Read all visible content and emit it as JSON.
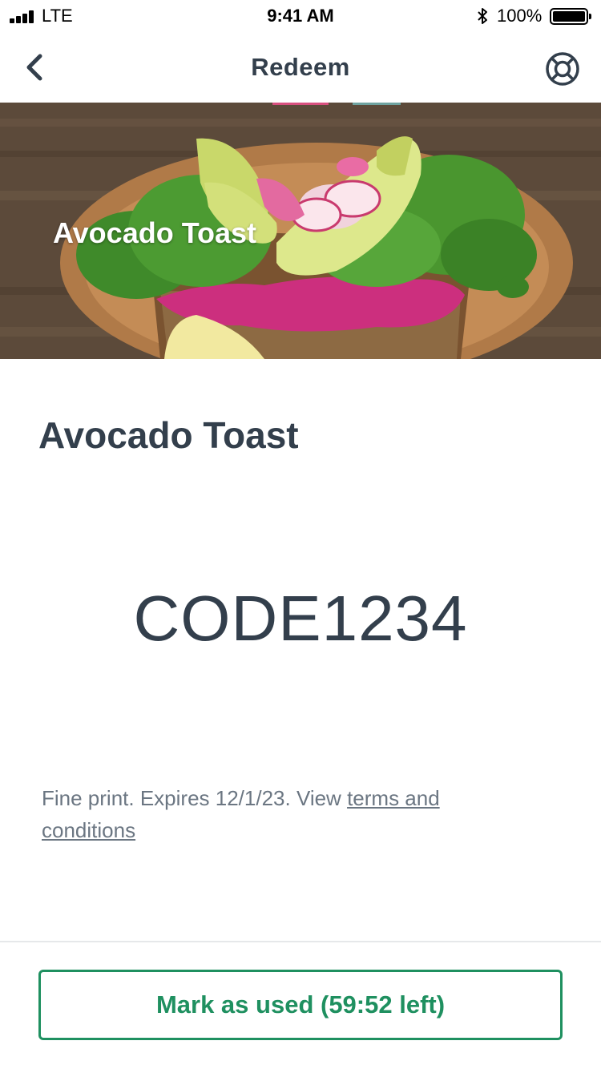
{
  "status_bar": {
    "carrier": "LTE",
    "time": "9:41 AM",
    "battery_percent": "100%",
    "battery_level": 1.0
  },
  "nav": {
    "title": "Redeem",
    "back_icon": "chevron-left-icon",
    "help_icon": "lifebuoy-icon"
  },
  "hero": {
    "title": "Avocado Toast"
  },
  "offer": {
    "title": "Avocado Toast",
    "code": "CODE1234",
    "fine_print": "Fine print. Expires 12/1/23. View ",
    "terms_link": "terms and conditions"
  },
  "action": {
    "label": "Mark as used (59:52 left)"
  },
  "colors": {
    "text_primary": "#333f4c",
    "text_secondary": "#6b7682",
    "accent_green": "#1f9060"
  }
}
